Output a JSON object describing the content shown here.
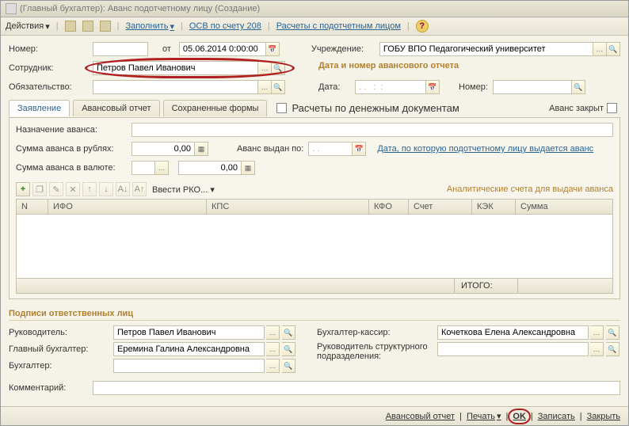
{
  "titlebar": "(Главный бухгалтер): Аванс подотчетному лицу (Создание)",
  "toolbar": {
    "actions": "Действия",
    "fill": "Заполнить",
    "osb": "ОСВ по счету 208",
    "calc": "Расчеты с подотчетным лицом"
  },
  "header": {
    "number_label": "Номер:",
    "from": "от",
    "date": "05.06.2014 0:00:00",
    "inst_label": "Учреждение:",
    "institution": "ГОБУ ВПО Педагогический университет",
    "employee_label": "Сотрудник:",
    "employee": "Петров Павел Иванович",
    "obligation_label": "Обязательство:",
    "report_section": "Дата и номер авансового отчета",
    "date_label": "Дата:",
    "date_mask": ". .   :  :",
    "number2_label": "Номер:"
  },
  "tabs": {
    "t1": "Заявление",
    "t2": "Авансовый отчет",
    "t3": "Сохраненные формы",
    "chk_label": "Расчеты по денежным документам",
    "closed_label": "Аванс закрыт"
  },
  "form": {
    "purpose_label": "Назначение аванса:",
    "sum_rub_label": "Сумма аванса в рублях:",
    "sum_rub": "0,00",
    "issued_label": "Аванс выдан по:",
    "issued_mask": ". .",
    "issued_link": "Дата, по которую подотчетному лицу выдается аванс",
    "sum_cur_label": "Сумма аванса в валюте:",
    "sum_cur": "0,00",
    "pko": "Ввести РКО...",
    "analytics": "Аналитические счета для выдачи аванса",
    "cols": {
      "n": "N",
      "ifo": "ИФО",
      "kps": "КПС",
      "kfo": "КФО",
      "acct": "Счет",
      "kek": "КЭК",
      "sum": "Сумма"
    },
    "total": "ИТОГО:"
  },
  "sign": {
    "head": "Подписи ответственных лиц",
    "manager_label": "Руководитель:",
    "manager": "Петров Павел Иванович",
    "cashier_label": "Бухгалтер-кассир:",
    "cashier": "Кочеткова Елена Александровна",
    "chief_label": "Главный бухгалтер:",
    "chief": "Еремина Галина Александровна",
    "struct_label": "Руководитель структурного подразделения:",
    "acct_label": "Бухгалтер:"
  },
  "comment_label": "Комментарий:",
  "footer": {
    "report": "Авансовый отчет",
    "print": "Печать",
    "ok": "OK",
    "save": "Записать",
    "close": "Закрыть"
  }
}
